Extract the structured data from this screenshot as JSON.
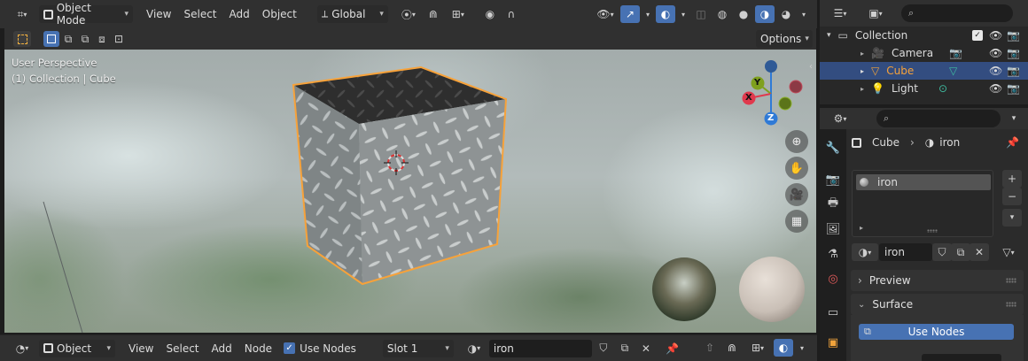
{
  "viewport_header": {
    "mode": "Object Mode",
    "menus": [
      "View",
      "Select",
      "Add",
      "Object"
    ],
    "transform_orientation": "Global",
    "options_label": "Options"
  },
  "viewport": {
    "perspective_label": "User Perspective",
    "collection_label": "(1) Collection | Cube",
    "gizmo_axes": [
      "X",
      "Y",
      "Z"
    ]
  },
  "shader_header": {
    "object_type": "Object",
    "menus": [
      "View",
      "Select",
      "Add",
      "Node"
    ],
    "use_nodes_label": "Use Nodes",
    "use_nodes_checked": true,
    "slot": "Slot 1",
    "material": "iron"
  },
  "outliner": {
    "collection": "Collection",
    "items": [
      {
        "label": "Camera",
        "icon": "camera-icon",
        "selected": false
      },
      {
        "label": "Cube",
        "icon": "mesh-icon",
        "selected": true
      },
      {
        "label": "Light",
        "icon": "light-icon",
        "selected": false
      }
    ]
  },
  "properties": {
    "breadcrumb_object": "Cube",
    "breadcrumb_material": "iron",
    "material_slots": [
      "iron"
    ],
    "material_name": "iron",
    "panels": {
      "preview": "Preview",
      "surface": "Surface"
    },
    "use_nodes_button": "Use Nodes"
  },
  "colors": {
    "accent_blue": "#4772b3",
    "selection_orange": "#f7a23a",
    "axis_x": "#e0394d",
    "axis_y": "#7fa01e",
    "axis_z": "#2f7ad6"
  }
}
